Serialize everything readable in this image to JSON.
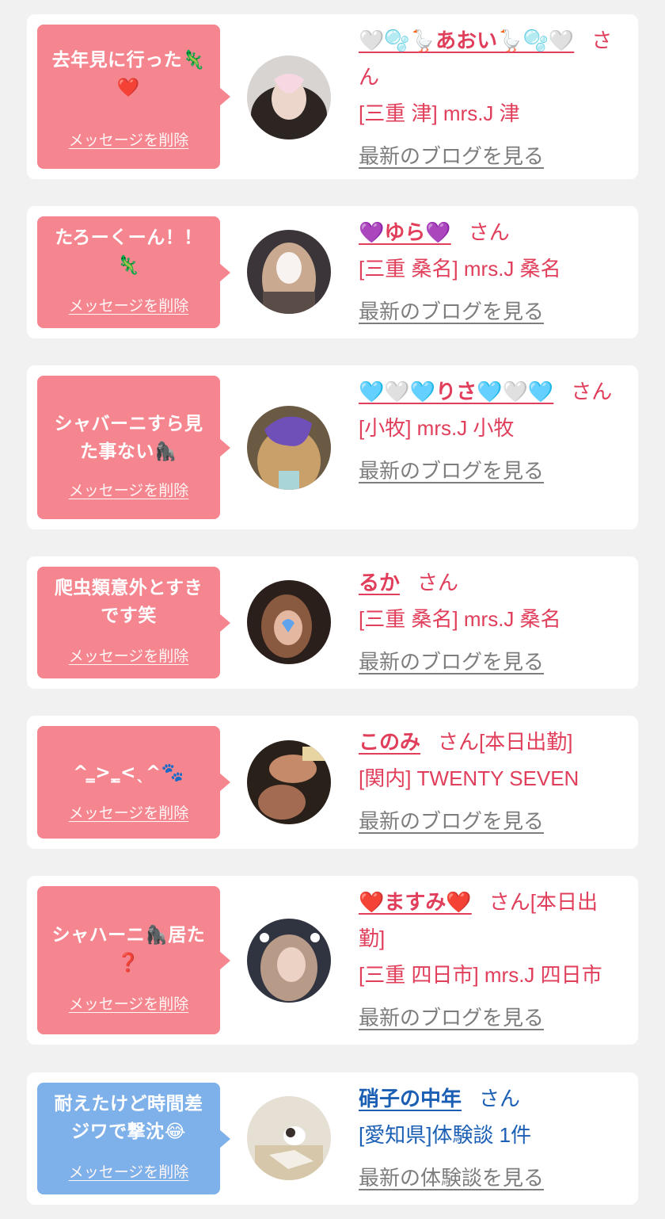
{
  "cards": [
    {
      "message": "去年見に行った🦎\n❤️",
      "delete_label": "メッセージを削除",
      "name": "🤍🫧🪿あおい🪿🫧🤍",
      "san": "さん",
      "store": "[三重 津] mrs.J 津",
      "link": "最新のブログを見る",
      "bubble_color": "#f5868f"
    },
    {
      "message": "たろーくーん！！\n🦎",
      "delete_label": "メッセージを削除",
      "name": "💜ゆら💜",
      "san": "さん",
      "store": "[三重 桑名] mrs.J 桑名",
      "link": "最新のブログを見る",
      "bubble_color": "#f5868f"
    },
    {
      "message": "シャバーニすら見\nた事ない🦍",
      "delete_label": "メッセージを削除",
      "name": "🩵🤍🩵りさ🩵🤍🩵",
      "san": "さん",
      "store": "[小牧] mrs.J 小牧",
      "link": "最新のブログを見る",
      "bubble_color": "#f5868f"
    },
    {
      "message": "爬虫類意外とすき\nです笑",
      "delete_label": "メッセージを削除",
      "name": "るか",
      "san": "さん",
      "store": "[三重 桑名] mrs.J 桑名",
      "link": "最新のブログを見る",
      "bubble_color": "#f5868f"
    },
    {
      "message": "^ ̳>ˎ̳<ˎ^🐾",
      "delete_label": "メッセージを削除",
      "name": "このみ",
      "san": "さん[本日出勤]",
      "store": "[関内] TWENTY SEVEN",
      "link": "最新のブログを見る",
      "bubble_color": "#f5868f"
    },
    {
      "message": "シャハーニ🦍居た\n❓",
      "delete_label": "メッセージを削除",
      "name": "❤️ますみ❤️",
      "san": "さん[本日出勤]",
      "store": "[三重 四日市] mrs.J 四日市",
      "link": "最新のブログを見る",
      "bubble_color": "#f5868f"
    },
    {
      "message": "耐えたけど時間差\nジワで撃沈😂",
      "delete_label": "メッセージを削除",
      "name": "硝子の中年",
      "san": "さん",
      "store": "[愛知県]体験談 1件",
      "link": "最新の体験談を見る",
      "bubble_color": "#7eb0ea"
    }
  ]
}
